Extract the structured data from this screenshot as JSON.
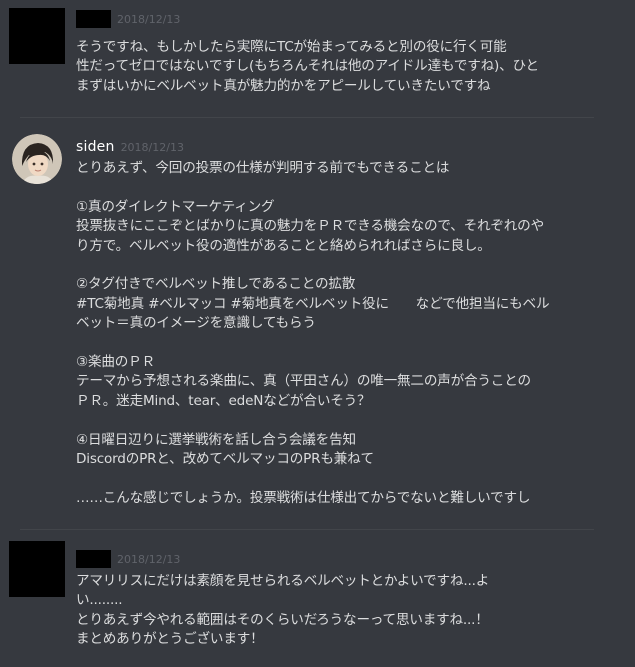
{
  "messages": [
    {
      "author_visible": "",
      "timestamp": "2018/12/13",
      "text": "そうですね、もしかしたら実際にTCが始まってみると別の役に行く可能\n性だってゼロではないですし(もちろんそれは他のアイドル達もですね)、ひと\nまずはいかにベルベット真が魅力的かをアピールしていきたいですね"
    },
    {
      "author_visible": "siden",
      "timestamp": "2018/12/13",
      "text": "とりあえず、今回の投票の仕様が判明する前でもできることは\n\n①真のダイレクトマーケティング\n投票抜きにここぞとばかりに真の魅力をＰＲできる機会なので、それぞれのや\nり方で。ベルベット役の適性があることと絡められればさらに良し。\n\n②タグ付きでベルベット推しであることの拡散\n#TC菊地真 #ベルマッコ #菊地真をベルベット役に　　などで他担当にもベル\nベット＝真のイメージを意識してもらう\n\n③楽曲のＰＲ\nテーマから予想される楽曲に、真（平田さん）の唯一無二の声が合うことの\nＰＲ。迷走Mind、tear、edeNなどが合いそう？\n\n④日曜日辺りに選挙戦術を話し合う会議を告知\nDiscordのPRと、改めてベルマッコのPRも兼ねて\n\n……こんな感じでしょうか。投票戦術は仕様出てからでないと難しいですし"
    },
    {
      "author_visible": "",
      "timestamp": "2018/12/13",
      "text": "アマリリスにだけは素顔を見せられるベルベットとかよいですね...よ\nい........\nとりあえず今やれる範囲はそのくらいだろうなーって思いますね...！\nまとめありがとうございます！"
    }
  ],
  "colors": {
    "background": "#36393f",
    "text": "#dcddde",
    "username": "#ffffff",
    "timestamp": "#60636a",
    "divider": "#42454a"
  }
}
